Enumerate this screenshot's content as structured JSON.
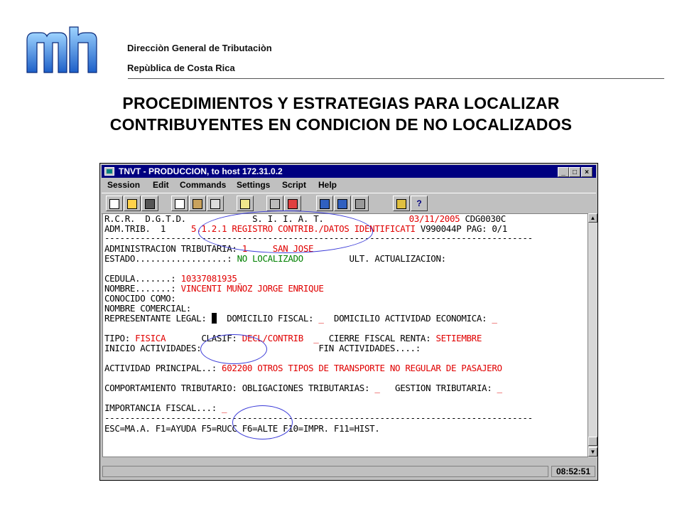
{
  "header": {
    "org_line1": "Direcciòn General de Tributaciòn",
    "org_line2": "Repùblica de Costa Rica",
    "title_line1": "PROCEDIMIENTOS Y ESTRATEGIAS PARA LOCALIZAR",
    "title_line2": "CONTRIBUYENTES EN CONDICION DE NO LOCALIZADOS"
  },
  "window": {
    "title": "TNVT  -  PRODUCCION, to host 172.31.0.2",
    "menu": [
      "Session",
      "Edit",
      "Commands",
      "Settings",
      "Script",
      "Help"
    ],
    "clock": "08:52:51"
  },
  "screen": {
    "l1a": "R.C.R.  D.G.T.D.             S. I. I. A. T.",
    "l1b": "03/11/2005",
    "l1c": " CDG0030C",
    "l2a": "ADM.TRIB.  1     ",
    "l2b": "5.1.2.1 REGISTRO CONTRIB./DATOS IDENTIFICATI",
    "l2c": " V990044P PAG: 0/1",
    "sep": "------------------------------------------------------------------------------------",
    "l3a": "ADMINISTRACION TRIBUTARIA: ",
    "l3b": "1     SAN JOSE",
    "l4a": "ESTADO..................: ",
    "l4b": "NO LOCALIZADO",
    "l4c": "         ULT. ACTUALIZACION:",
    "l5a": "CEDULA.......: ",
    "l5b": "10337081935",
    "l6a": "NOMBRE.......: ",
    "l6b": "VINCENTI MUÑOZ JORGE ENRIQUE",
    "l7": "CONOCIDO COMO:",
    "l8": "NOMBRE COMERCIAL:",
    "l9a": "REPRESENTANTE LEGAL: ",
    "l9b": "_",
    "l9c": "  DOMICILIO FISCAL: ",
    "l9d": "_",
    "l9e": "  DOMICILIO ACTIVIDAD ECONOMICA: ",
    "l9f": "_",
    "l10a": "TIPO: ",
    "l10b": "FISICA",
    "l10c": "       CLASIF: ",
    "l10d": "DECL/CONTRIB  _",
    "l10e": "  CIERRE FISCAL RENTA: ",
    "l10f": "SETIEMBRE",
    "l11": "INICIO ACTIVIDADES:                       FIN ACTIVIDADES....:",
    "l12a": "ACTIVIDAD PRINCIPAL..: ",
    "l12b": "602200 OTROS TIPOS DE TRANSPORTE NO REGULAR DE PASAJERO",
    "l13a": "COMPORTAMIENTO TRIBUTARIO: OBLIGACIONES TRIBUTARIAS: ",
    "l13b": "_",
    "l13c": "   GESTION TRIBUTARIA: ",
    "l13d": "_",
    "l14a": "IMPORTANCIA FISCAL...: ",
    "l14b": "_",
    "l15": "ESC=MA.A. F1=AYUDA F5=RUCC F6=ALTE F10=IMPR. F11=HIST."
  },
  "colors": {
    "title_bar": "#000080",
    "field_value": "#e00000",
    "status_value": "#008000",
    "annotation": "#3b3bd8"
  }
}
